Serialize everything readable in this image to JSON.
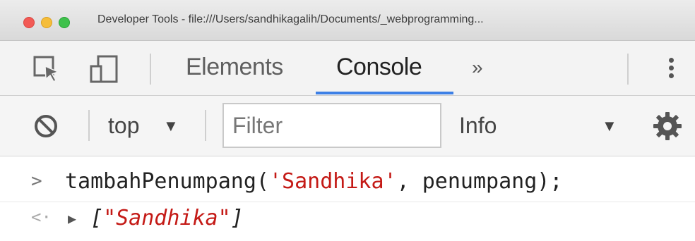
{
  "window": {
    "title": "Developer Tools - file:///Users/sandhikagalih/Documents/_webprogramming..."
  },
  "tabs": {
    "items": [
      {
        "label": "Elements",
        "active": false
      },
      {
        "label": "Console",
        "active": true
      }
    ],
    "more": "»"
  },
  "toolbar": {
    "context": "top",
    "context_arrow": "▼",
    "filter_placeholder": "Filter",
    "level": "Info",
    "level_arrow": "▼"
  },
  "console": {
    "input": {
      "prompt": ">",
      "fn": "tambahPenumpang(",
      "arg_string": "'Sandhika'",
      "rest": ", penumpang);"
    },
    "output": {
      "prompt": "<·",
      "expand": "▶",
      "open": "[",
      "value": "\"Sandhika\"",
      "close": "]"
    }
  },
  "colors": {
    "accent": "#3d80e6",
    "string": "#c41a16",
    "close": "#f25a55",
    "minimize": "#f5bd3a",
    "maximize": "#3fc14c"
  }
}
